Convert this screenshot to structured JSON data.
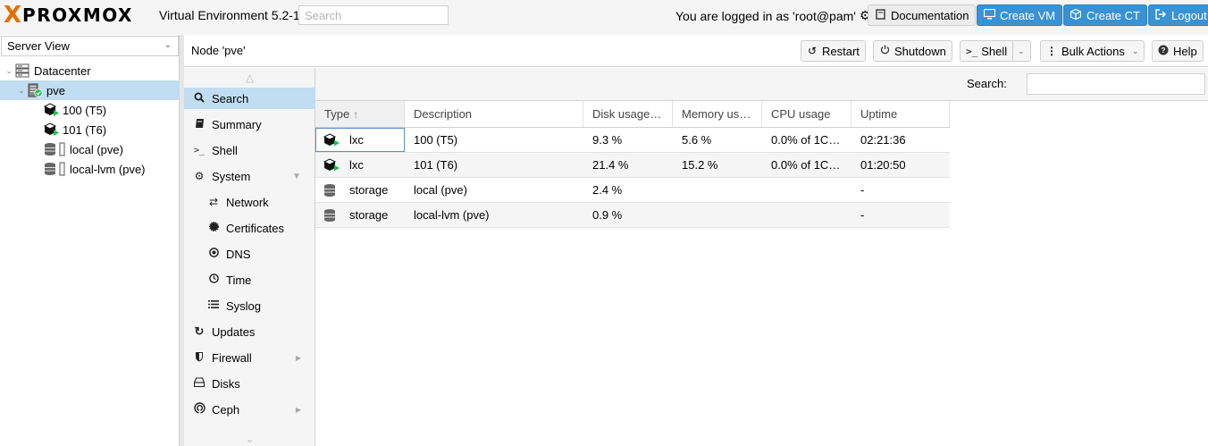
{
  "topbar": {
    "logo_x": "X",
    "logo_word": "PROXMOX",
    "version": "Virtual Environment 5.2-1",
    "search_placeholder": "Search",
    "login_text": "You are logged in as 'root@pam'",
    "buttons": {
      "documentation": "Documentation",
      "create_vm": "Create VM",
      "create_ct": "Create CT",
      "logout": "Logout"
    }
  },
  "sidebar": {
    "view": "Server View",
    "tree": [
      {
        "label": "Datacenter",
        "icon": "datacenter-icon"
      },
      {
        "label": "pve",
        "icon": "node-online-icon"
      },
      {
        "label": "100 (T5)",
        "icon": "container-running-icon"
      },
      {
        "label": "101 (T6)",
        "icon": "container-running-icon"
      },
      {
        "label": "local (pve)",
        "icon": "storage-icon"
      },
      {
        "label": "local-lvm (pve)",
        "icon": "storage-icon"
      }
    ]
  },
  "node": {
    "title": "Node 'pve'",
    "buttons": {
      "restart": "Restart",
      "shutdown": "Shutdown",
      "shell": "Shell",
      "bulk_actions": "Bulk Actions",
      "help": "Help"
    }
  },
  "menu": {
    "items": [
      {
        "label": "Search",
        "icon": "search-icon"
      },
      {
        "label": "Summary",
        "icon": "book-icon"
      },
      {
        "label": "Shell",
        "icon": "terminal-icon"
      },
      {
        "label": "System",
        "icon": "cogs-icon"
      },
      {
        "label": "Network",
        "icon": "exchange-icon"
      },
      {
        "label": "Certificates",
        "icon": "certificate-icon"
      },
      {
        "label": "DNS",
        "icon": "globe-icon"
      },
      {
        "label": "Time",
        "icon": "clock-icon"
      },
      {
        "label": "Syslog",
        "icon": "list-icon"
      },
      {
        "label": "Updates",
        "icon": "refresh-icon"
      },
      {
        "label": "Firewall",
        "icon": "shield-icon"
      },
      {
        "label": "Disks",
        "icon": "hdd-icon"
      },
      {
        "label": "Ceph",
        "icon": "ceph-icon"
      }
    ]
  },
  "search": {
    "label": "Search:",
    "value": ""
  },
  "grid": {
    "columns": [
      "Type",
      "Description",
      "Disk usage…",
      "Memory us…",
      "CPU usage",
      "Uptime"
    ],
    "sorted_column": "Type",
    "rows": [
      [
        "lxc",
        "100 (T5)",
        "9.3 %",
        "5.6 %",
        "0.0% of 1C…",
        "02:21:36"
      ],
      [
        "lxc",
        "101 (T6)",
        "21.4 %",
        "15.2 %",
        "0.0% of 1C…",
        "01:20:50"
      ],
      [
        "storage",
        "local (pve)",
        "2.4 %",
        "",
        "",
        "-"
      ],
      [
        "storage",
        "local-lvm (pve)",
        "0.9 %",
        "",
        "",
        "-"
      ]
    ]
  },
  "colors": {
    "accent": "#3892d4",
    "selection": "#c1ddf1",
    "logo": "#e57000",
    "running": "#21bf4b"
  }
}
